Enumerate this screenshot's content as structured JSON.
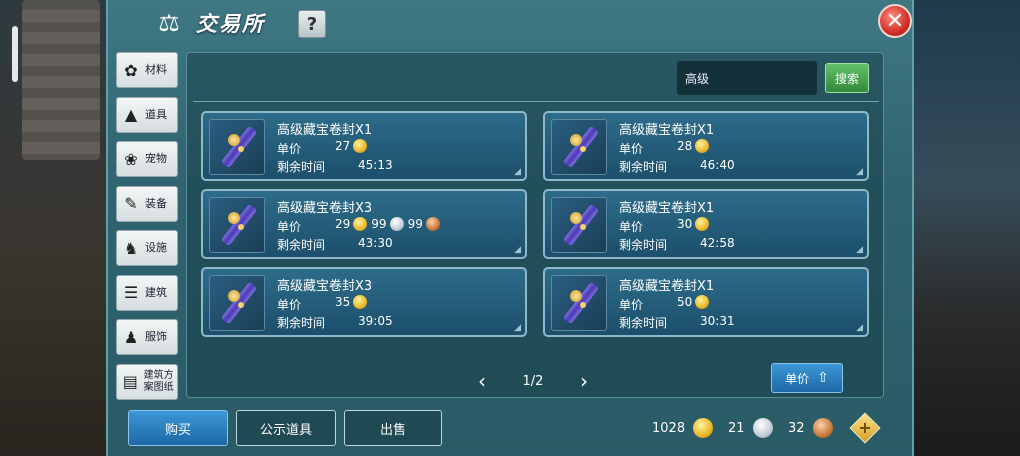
{
  "header": {
    "title": "交易所",
    "help_label": "?",
    "close_label": "✕"
  },
  "categories": [
    {
      "label": "材料",
      "icon": "materials-icon"
    },
    {
      "label": "道具",
      "icon": "item-icon"
    },
    {
      "label": "宠物",
      "icon": "paw-icon"
    },
    {
      "label": "装备",
      "icon": "equipment-icon"
    },
    {
      "label": "设施",
      "icon": "facility-icon"
    },
    {
      "label": "建筑",
      "icon": "building-icon"
    },
    {
      "label": "服饰",
      "icon": "clothing-icon"
    },
    {
      "label": "建筑方案图纸",
      "icon": "blueprint-icon"
    }
  ],
  "search": {
    "value": "高级",
    "button_label": "搜索"
  },
  "listing_labels": {
    "price": "单价",
    "time_left": "剩余时间"
  },
  "listings": [
    {
      "name": "高级藏宝卷封X1",
      "gold": "27",
      "silver": "",
      "copper": "",
      "time": "45:13"
    },
    {
      "name": "高级藏宝卷封X1",
      "gold": "28",
      "silver": "",
      "copper": "",
      "time": "46:40"
    },
    {
      "name": "高级藏宝卷封X3",
      "gold": "29",
      "silver": "99",
      "copper": "99",
      "time": "43:30"
    },
    {
      "name": "高级藏宝卷封X1",
      "gold": "30",
      "silver": "",
      "copper": "",
      "time": "42:58"
    },
    {
      "name": "高级藏宝卷封X3",
      "gold": "35",
      "silver": "",
      "copper": "",
      "time": "39:05"
    },
    {
      "name": "高级藏宝卷封X1",
      "gold": "50",
      "silver": "",
      "copper": "",
      "time": "30:31"
    }
  ],
  "pagination": {
    "text": "1/2",
    "prev": "‹",
    "next": "›"
  },
  "sort": {
    "label": "单价",
    "direction_icon": "arrow-up-icon"
  },
  "bottom_tabs": {
    "buy": "购买",
    "public": "公示道具",
    "sell": "出售"
  },
  "wallet": {
    "gold": "1028",
    "silver": "21",
    "copper": "32"
  },
  "colors": {
    "panel": "#2f6470",
    "item_bg": "#1c4f6b",
    "active_button": "#1e68a6",
    "search_button": "#318a3a",
    "close_button": "#d0312a"
  }
}
